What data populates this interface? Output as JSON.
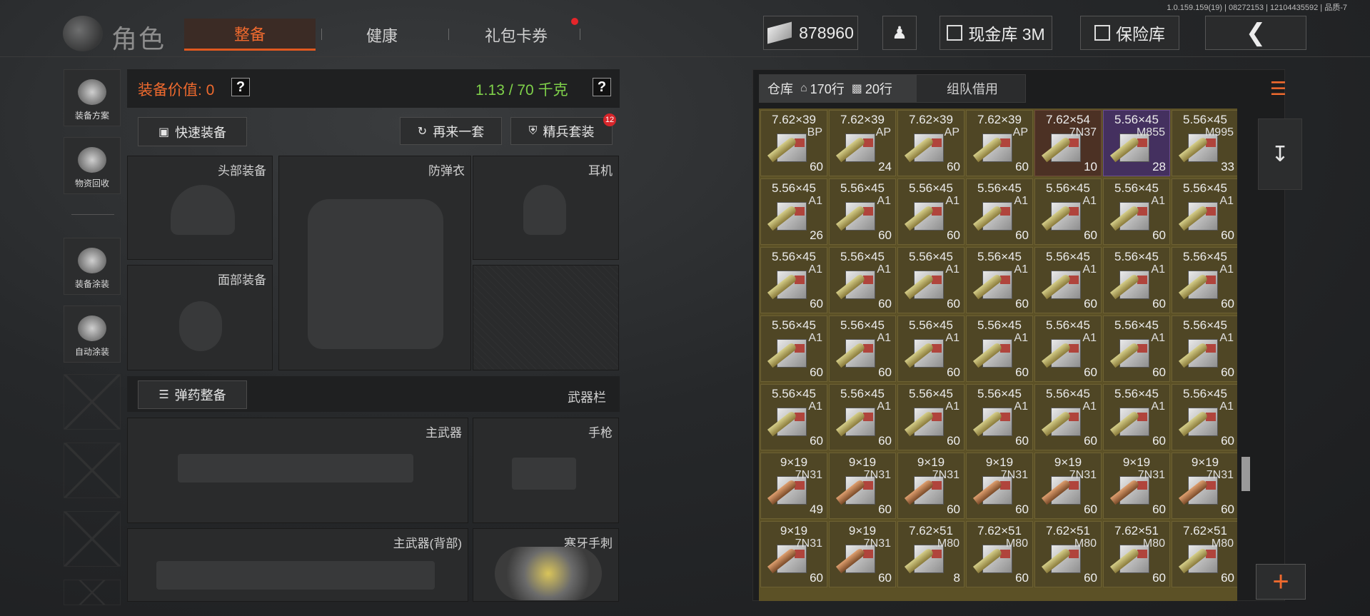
{
  "version": "1.0.159.159(19) | 08272153 | 12104435592 | 品质-7",
  "header": {
    "title": "角色",
    "tabs": [
      {
        "label": "整备",
        "active": true
      },
      {
        "label": "健康",
        "active": false
      },
      {
        "label": "礼包卡券",
        "active": false,
        "notification": true
      }
    ],
    "money": "878960",
    "cash_vault": "现金库 3M",
    "safe": "保险库"
  },
  "sidebar": {
    "items": [
      {
        "label": "装备方案",
        "icon": "helmet-plan-icon"
      },
      {
        "label": "物资回收",
        "icon": "recycle-icon"
      },
      {
        "label": "装备涂装",
        "icon": "helmet-paint-icon"
      },
      {
        "label": "自动涂装",
        "icon": "brush-gear-icon"
      }
    ]
  },
  "equipment": {
    "value_label": "装备价值: 0",
    "weight": "1.13 / 70 千克",
    "quick_equip": "快速装备",
    "again": "再来一套",
    "elite": "精兵套装",
    "elite_badge": "12",
    "slots": {
      "head": "头部装备",
      "armor": "防弹衣",
      "headset": "耳机",
      "face": "面部装备",
      "primary": "主武器",
      "pistol": "手枪",
      "primary_back": "主武器(背部)",
      "melee": "寒牙手刺"
    },
    "ammo_button": "弹药整备",
    "weapon_bar": "武器栏"
  },
  "inventory": {
    "tab_storage": "仓库",
    "storage_rows": "170行",
    "storage_rows2": "20行",
    "tab_team": "组队借用",
    "items": [
      [
        "7.62×39",
        "BP",
        "60",
        "gold"
      ],
      [
        "7.62×39",
        "AP",
        "24",
        "gold"
      ],
      [
        "7.62×39",
        "AP",
        "60",
        "gold"
      ],
      [
        "7.62×39",
        "AP",
        "60",
        "gold"
      ],
      [
        "7.62×54",
        "7N37",
        "10",
        "red"
      ],
      [
        "5.56×45",
        "M855",
        "28",
        "purple"
      ],
      [
        "5.56×45",
        "M995",
        "33",
        "gold"
      ],
      [
        "5.56×45",
        "A1",
        "26",
        "gold"
      ],
      [
        "5.56×45",
        "A1",
        "60",
        "gold"
      ],
      [
        "5.56×45",
        "A1",
        "60",
        "gold"
      ],
      [
        "5.56×45",
        "A1",
        "60",
        "gold"
      ],
      [
        "5.56×45",
        "A1",
        "60",
        "gold"
      ],
      [
        "5.56×45",
        "A1",
        "60",
        "gold"
      ],
      [
        "5.56×45",
        "A1",
        "60",
        "gold"
      ],
      [
        "5.56×45",
        "A1",
        "60",
        "gold"
      ],
      [
        "5.56×45",
        "A1",
        "60",
        "gold"
      ],
      [
        "5.56×45",
        "A1",
        "60",
        "gold"
      ],
      [
        "5.56×45",
        "A1",
        "60",
        "gold"
      ],
      [
        "5.56×45",
        "A1",
        "60",
        "gold"
      ],
      [
        "5.56×45",
        "A1",
        "60",
        "gold"
      ],
      [
        "5.56×45",
        "A1",
        "60",
        "gold"
      ],
      [
        "5.56×45",
        "A1",
        "60",
        "gold"
      ],
      [
        "5.56×45",
        "A1",
        "60",
        "gold"
      ],
      [
        "5.56×45",
        "A1",
        "60",
        "gold"
      ],
      [
        "5.56×45",
        "A1",
        "60",
        "gold"
      ],
      [
        "5.56×45",
        "A1",
        "60",
        "gold"
      ],
      [
        "5.56×45",
        "A1",
        "60",
        "gold"
      ],
      [
        "5.56×45",
        "A1",
        "60",
        "gold"
      ],
      [
        "5.56×45",
        "A1",
        "60",
        "gold"
      ],
      [
        "5.56×45",
        "A1",
        "60",
        "gold"
      ],
      [
        "5.56×45",
        "A1",
        "60",
        "gold"
      ],
      [
        "5.56×45",
        "A1",
        "60",
        "gold"
      ],
      [
        "5.56×45",
        "A1",
        "60",
        "gold"
      ],
      [
        "5.56×45",
        "A1",
        "60",
        "gold"
      ],
      [
        "5.56×45",
        "A1",
        "60",
        "gold"
      ],
      [
        "9×19",
        "7N31",
        "49",
        "gold"
      ],
      [
        "9×19",
        "7N31",
        "60",
        "gold"
      ],
      [
        "9×19",
        "7N31",
        "60",
        "gold"
      ],
      [
        "9×19",
        "7N31",
        "60",
        "gold"
      ],
      [
        "9×19",
        "7N31",
        "60",
        "gold"
      ],
      [
        "9×19",
        "7N31",
        "60",
        "gold"
      ],
      [
        "9×19",
        "7N31",
        "60",
        "gold"
      ],
      [
        "9×19",
        "7N31",
        "60",
        "gold"
      ],
      [
        "9×19",
        "7N31",
        "60",
        "gold"
      ],
      [
        "7.62×51",
        "M80",
        "8",
        "gold"
      ],
      [
        "7.62×51",
        "M80",
        "60",
        "gold"
      ],
      [
        "7.62×51",
        "M80",
        "60",
        "gold"
      ],
      [
        "7.62×51",
        "M80",
        "60",
        "gold"
      ],
      [
        "7.62×51",
        "M80",
        "60",
        "gold"
      ]
    ]
  }
}
